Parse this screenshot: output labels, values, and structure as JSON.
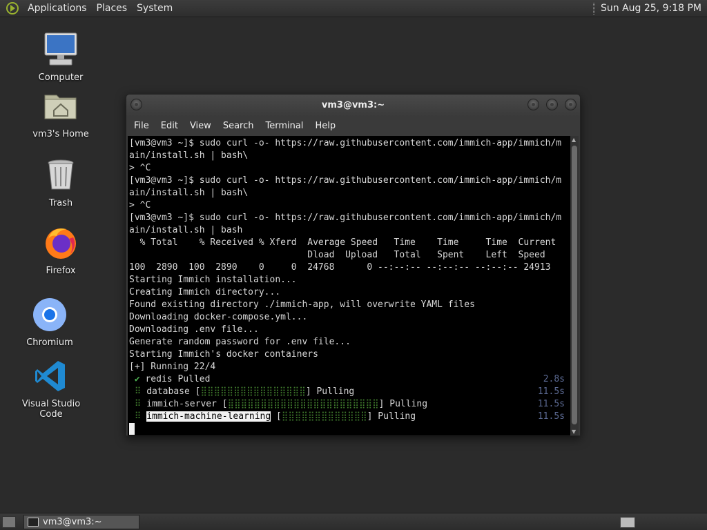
{
  "top_panel": {
    "menus": [
      "Applications",
      "Places",
      "System"
    ],
    "clock": "Sun Aug 25,  9:18 PM"
  },
  "desktop_icons": [
    {
      "label": "Computer",
      "icon": "computer-icon"
    },
    {
      "label": "vm3's Home",
      "icon": "home-folder-icon"
    },
    {
      "label": "Trash",
      "icon": "trash-icon"
    },
    {
      "label": "Firefox",
      "icon": "firefox-icon"
    },
    {
      "label": "Chromium",
      "icon": "chromium-icon"
    },
    {
      "label": "Visual Studio Code",
      "icon": "vscode-icon"
    }
  ],
  "terminal": {
    "title": "vm3@vm3:~",
    "menu": [
      "File",
      "Edit",
      "View",
      "Search",
      "Terminal",
      "Help"
    ],
    "lines": [
      "[vm3@vm3 ~]$ sudo curl -o- https://raw.githubusercontent.com/immich-app/immich/m",
      "ain/install.sh | bash\\",
      "> ^C",
      "[vm3@vm3 ~]$ sudo curl -o- https://raw.githubusercontent.com/immich-app/immich/m",
      "ain/install.sh | bash\\",
      "> ^C",
      "[vm3@vm3 ~]$ sudo curl -o- https://raw.githubusercontent.com/immich-app/immich/m",
      "ain/install.sh | bash",
      "  % Total    % Received % Xferd  Average Speed   Time    Time     Time  Current",
      "                                 Dload  Upload   Total   Spent    Left  Speed",
      "100  2890  100  2890    0     0  24768      0 --:--:-- --:--:-- --:--:-- 24913",
      "Starting Immich installation...",
      "Creating Immich directory...",
      "Found existing directory ./immich-app, will overwrite YAML files",
      "Downloading docker-compose.yml...",
      "Downloading .env file...",
      "Generate random password for .env file...",
      "Starting Immich's docker containers",
      "[+] Running 22/4"
    ],
    "progress": [
      {
        "status": "✔",
        "name": "redis",
        "bar": "",
        "state": "Pulled",
        "time": "2.8s"
      },
      {
        "status": "⠿",
        "name": "database",
        "bar": "⣿⣿⣿⣿⣿⣿⣿⣿⣿⣿⣿⣿⣿⣿⣿⣿",
        "state": "Pulling",
        "time": "11.5s"
      },
      {
        "status": "⠿",
        "name": "immich-server",
        "bar": "⣿⣿⣿⣿⣿⣿⣿⣿⣿⣿⣿⣿⣿⣿⣿⣿⣿⣿⣿⣿⣿⣿⣿",
        "state": "Pulling",
        "time": "11.5s"
      },
      {
        "status": "⠿",
        "name": "immich-machine-learning",
        "bar": "⣿⣿⣿⣿⣿⣿⣿⣿⣿⣿⣿⣿⣿",
        "state": "Pulling",
        "time": "11.5s"
      }
    ]
  },
  "taskbar": {
    "window_button": "vm3@vm3:~"
  }
}
